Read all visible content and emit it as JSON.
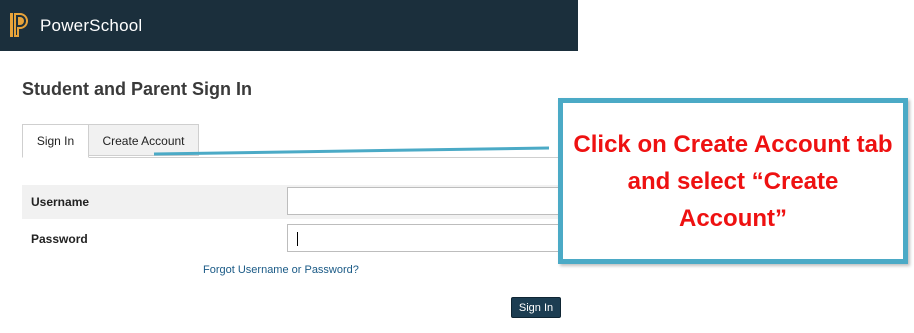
{
  "app": {
    "brand": "PowerSchool"
  },
  "page": {
    "title": "Student and Parent Sign In"
  },
  "tabs": [
    {
      "label": "Sign In",
      "active": true
    },
    {
      "label": "Create Account",
      "active": false
    }
  ],
  "form": {
    "username_label": "Username",
    "username_value": "",
    "password_label": "Password",
    "password_value": "",
    "forgot_link": "Forgot Username or Password?",
    "submit_label": "Sign In"
  },
  "callout": {
    "text": "Click on Create Account tab and select “Create Account”",
    "text_color": "#ee1111",
    "border_color": "#4baac6"
  },
  "colors": {
    "header_bg": "#1b2f3c",
    "button_bg": "#1c3d52",
    "link": "#1a5a86"
  },
  "icons": {
    "logo": "powerschool-logo-icon"
  }
}
